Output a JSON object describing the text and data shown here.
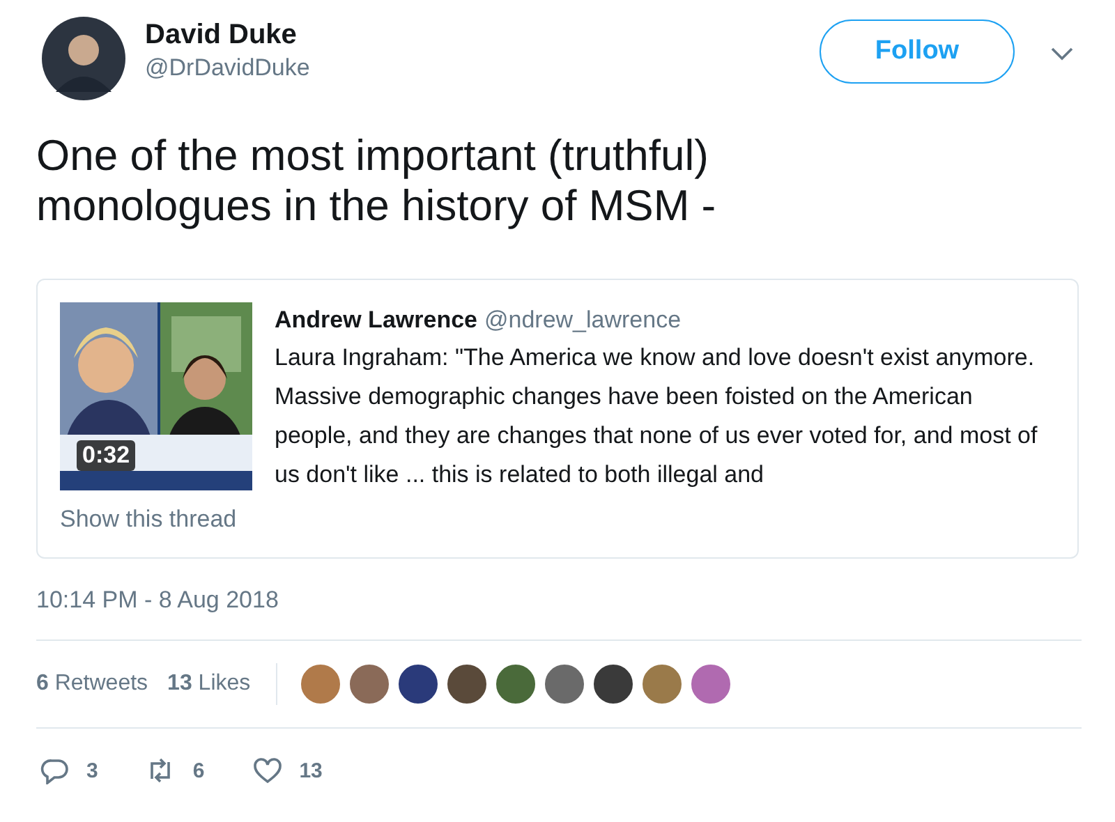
{
  "author": {
    "name": "David Duke",
    "handle": "@DrDavidDuke"
  },
  "follow_button": {
    "label": "Follow"
  },
  "tweet_text": "One of the most important (truthful) monologues in the history of MSM -",
  "quoted_tweet": {
    "name": "Andrew Lawrence",
    "handle": "@ndrew_lawrence",
    "video_duration": "0:32",
    "text": "Laura Ingraham: \"The America we know and love doesn't exist anymore. Massive demographic changes have been foisted on the American people, and they are changes that none of us ever voted for, and most of us don't like ... this is related to both illegal and",
    "thread_link": "Show this thread"
  },
  "timestamp": "10:14 PM - 8 Aug 2018",
  "stats": [
    {
      "text": "**6** Retweets"
    },
    {
      "text": "**13** Likes"
    }
  ],
  "liker_avatars": [
    {
      "color": "#b07a4a"
    },
    {
      "color": "#8a6a58"
    },
    {
      "color": "#2a3a7a"
    },
    {
      "color": "#5a4a3a"
    },
    {
      "color": "#4a6a3a"
    },
    {
      "color": "#6a6a6a"
    },
    {
      "color": "#3a3a3a"
    },
    {
      "color": "#9a7a4a"
    },
    {
      "color": "#b06ab0"
    }
  ],
  "actions": [
    {
      "kind": "reply",
      "count": "3"
    },
    {
      "kind": "retweet",
      "count": "6"
    },
    {
      "kind": "like",
      "count": "13"
    }
  ]
}
